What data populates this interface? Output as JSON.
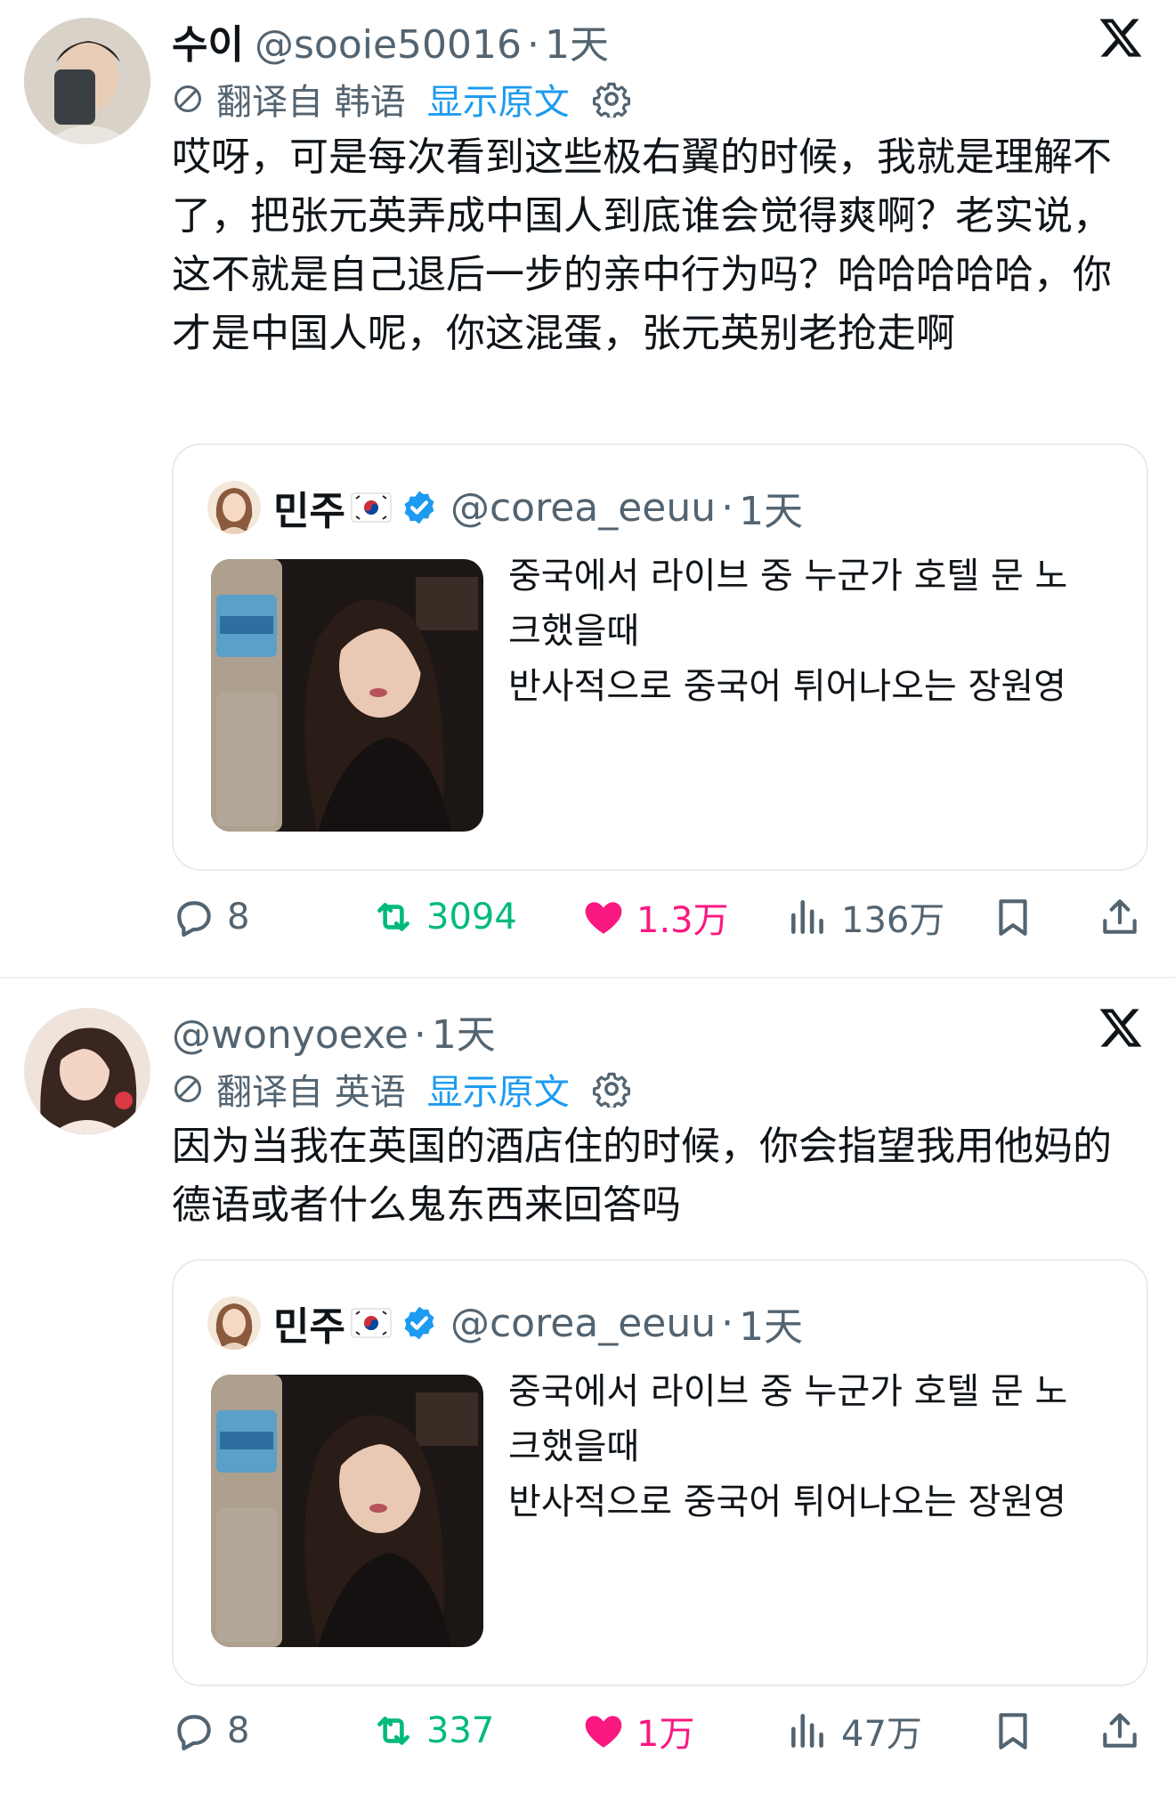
{
  "tweets": [
    {
      "display_name": "수이",
      "handle": "@sooie50016",
      "time": "1天",
      "translate_text": "翻译自 韩语",
      "show_original": "显示原文",
      "body": "哎呀，可是每次看到这些极右翼的时候，我就是理解不了，把张元英弄成中国人到底谁会觉得爽啊？老实说，这不就是自己退后一步的亲中行为吗？哈哈哈哈哈，你才是中国人呢，你这混蛋，张元英别老抢走啊",
      "quote": {
        "display_name": "민주",
        "handle": "@corea_eeuu",
        "time": "1天",
        "text_line1": "중국에서 라이브 중 누군가 호텔 문 노크했을때",
        "text_line2": "반사적으로 중국어 튀어나오는 장원영"
      },
      "stats": {
        "replies": "8",
        "retweets": "3094",
        "likes": "1.3万",
        "views": "136万"
      }
    },
    {
      "display_name": "",
      "handle": "@wonyoexe",
      "time": "1天",
      "translate_text": "翻译自 英语",
      "show_original": "显示原文",
      "body": "因为当我在英国的酒店住的时候，你会指望我用他妈的德语或者什么鬼东西来回答吗",
      "quote": {
        "display_name": "민주",
        "handle": "@corea_eeuu",
        "time": "1天",
        "text_line1": "중국에서 라이브 중 누군가 호텔 문 노크했을때",
        "text_line2": "반사적으로 중국어 튀어나오는 장원영"
      },
      "stats": {
        "replies": "8",
        "retweets": "337",
        "likes": "1万",
        "views": "47万"
      }
    }
  ],
  "colors": {
    "text_primary": "#0f1419",
    "text_secondary": "#536471",
    "link_blue": "#1d9bf0",
    "retweet_green": "#00ba7c",
    "like_pink": "#f91880",
    "border": "#e6ecf0"
  },
  "icons": [
    "x-logo-icon",
    "translate-icon",
    "gear-icon",
    "verified-badge-icon",
    "korea-flag-icon",
    "reply-icon",
    "retweet-icon",
    "heart-icon",
    "views-icon",
    "bookmark-icon",
    "share-icon"
  ]
}
